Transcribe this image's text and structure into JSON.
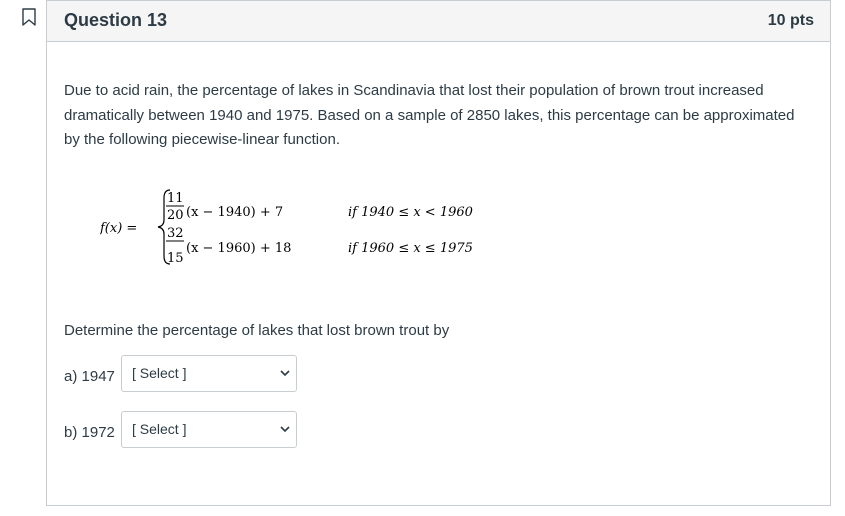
{
  "question": {
    "title": "Question 13",
    "points": "10 pts",
    "text": "Due to acid rain, the percentage of lakes in Scandinavia that lost their population of brown trout increased dramatically between 1940 and 1975. Based on a sample of 2850 lakes, this percentage can be approximated by the following piecewise-linear function.",
    "prompt": "Determine the percentage of lakes that lost brown trout by"
  },
  "formula": {
    "lhs": "f(x) =",
    "piece1": {
      "num": "11",
      "den": "20",
      "expr": "(x − 1940) + 7",
      "cond": "if 1940 ≤ x < 1960"
    },
    "piece2": {
      "num": "32",
      "den": "15",
      "expr": "(x − 1960) + 18",
      "cond": "if 1960 ≤ x ≤ 1975"
    }
  },
  "answers": [
    {
      "label": "a) 1947",
      "selected": "[ Select ]"
    },
    {
      "label": "b) 1972",
      "selected": "[ Select ]"
    }
  ],
  "colors": {
    "flag_border": "#2d3b45",
    "header_bg": "#f5f5f5",
    "border": "#c7cdd1",
    "text": "#2d3b45"
  }
}
